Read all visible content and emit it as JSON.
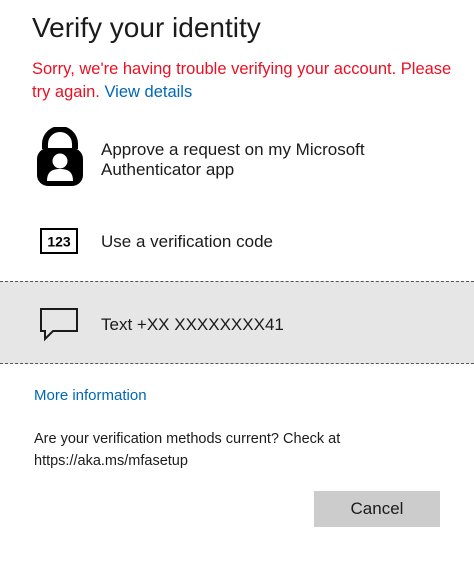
{
  "title": "Verify your identity",
  "error": {
    "message": "Sorry, we're having trouble verifying your account. Please try again.",
    "link": "View details",
    "color": "#e81123"
  },
  "options": [
    {
      "icon": "authenticator-lock-icon",
      "label": "Approve a request on my Microsoft Authenticator app"
    },
    {
      "icon": "verification-code-123-icon",
      "label": "Use a verification code"
    },
    {
      "icon": "text-message-icon",
      "label": "Text +XX XXXXXXXX41"
    }
  ],
  "more_info": "More information",
  "help_text": "Are your verification methods current? Check at https://aka.ms/mfasetup",
  "cancel_label": "Cancel",
  "colors": {
    "link": "#0067b8",
    "selected_bg": "#e6e6e6",
    "button_bg": "#cccccc"
  }
}
